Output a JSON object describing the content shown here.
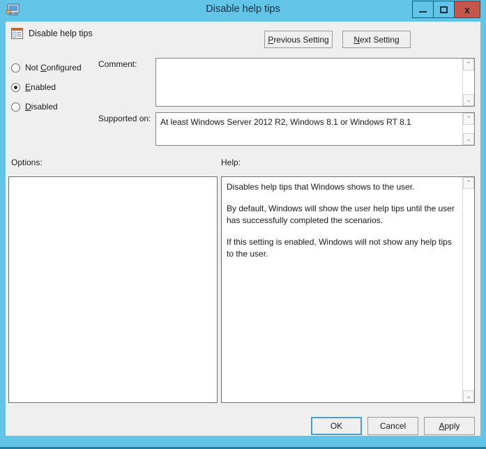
{
  "window": {
    "title": "Disable help tips",
    "icon": "computer-monitor-icon",
    "controls": {
      "minimize": "–",
      "maximize": "□",
      "close": "x"
    }
  },
  "header": {
    "setting_icon": "policy-setting-icon",
    "setting_name": "Disable help tips",
    "previous_setting": {
      "pre": "P",
      "post": "revious Setting"
    },
    "next_setting": {
      "pre": "N",
      "post": "ext Setting"
    }
  },
  "state_options": [
    {
      "id": "not-configured",
      "pre": "Not ",
      "accel": "C",
      "post": "onfigured",
      "checked": false
    },
    {
      "id": "enabled",
      "pre": "",
      "accel": "E",
      "post": "nabled",
      "checked": true
    },
    {
      "id": "disabled",
      "pre": "",
      "accel": "D",
      "post": "isabled",
      "checked": false
    }
  ],
  "fields": {
    "comment_label": "Comment:",
    "comment_value": "",
    "supported_on_label": "Supported on:",
    "supported_on_value": "At least Windows Server 2012 R2, Windows 8.1 or Windows RT 8.1"
  },
  "sections": {
    "options_label": "Options:",
    "help_label": "Help:"
  },
  "options_panel": {
    "content": ""
  },
  "help": {
    "paragraphs": [
      "Disables help tips that Windows shows to the user.",
      "By default, Windows will show the user help tips until the user has successfully completed the scenarios.",
      "If this setting is enabled, Windows will not show any help tips to the user."
    ]
  },
  "footer": {
    "ok": "OK",
    "cancel": "Cancel",
    "apply": {
      "pre": "A",
      "post": "pply"
    }
  },
  "scrollbar": {
    "up_arrow": "⌃",
    "down_arrow": "⌄"
  },
  "colors": {
    "titlebar": "#62c5e8",
    "close_button": "#c5564c",
    "dialog_bg": "#efefef",
    "panel_bg": "#ffffff",
    "default_button_focus": "#4a9ecb"
  }
}
